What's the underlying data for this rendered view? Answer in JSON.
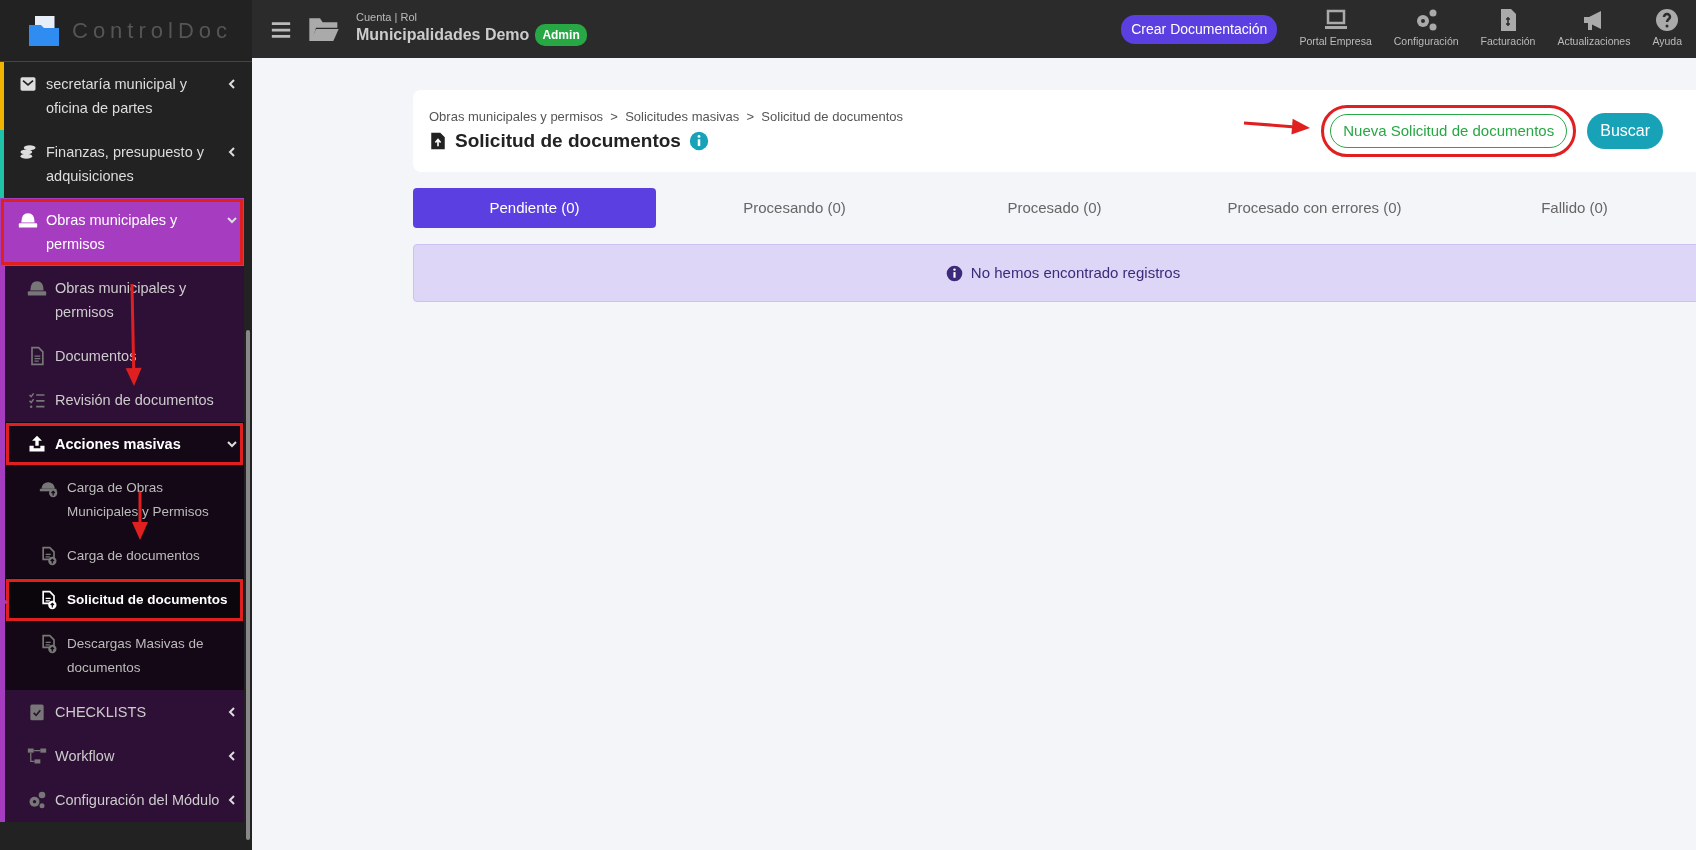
{
  "brand": {
    "name": "ControlDoc"
  },
  "header": {
    "account_label": "Cuenta | Rol",
    "account_name": "Municipalidades Demo",
    "role_badge": "Admin",
    "create_button": "Crear Documentación",
    "tools": [
      {
        "label": "Portal Empresa"
      },
      {
        "label": "Configuración"
      },
      {
        "label": "Facturación"
      },
      {
        "label": "Actualizaciones"
      },
      {
        "label": "Ayuda"
      }
    ]
  },
  "sidebar": {
    "items": [
      {
        "label": "secretaría municipal y oficina de partes",
        "color": "#f0b400",
        "expanded": false,
        "selected": false,
        "highlighted": false
      },
      {
        "label": "Finanzas, presupuesto y adquisiciones",
        "color": "#1fc3a8",
        "expanded": false,
        "selected": false,
        "highlighted": false
      },
      {
        "label": "Obras municipales y permisos",
        "color": "#a63cbf",
        "expanded": true,
        "selected": true,
        "highlighted": true,
        "children": [
          {
            "label": "Obras municipales y permisos",
            "selected": false,
            "highlighted": false
          },
          {
            "label": "Documentos",
            "selected": false,
            "highlighted": false
          },
          {
            "label": "Revisión de documentos",
            "selected": false,
            "highlighted": false
          },
          {
            "label": "Acciones masivas",
            "expanded": true,
            "selected": false,
            "highlighted": true,
            "children": [
              {
                "label": "Carga de Obras Municipales y Permisos",
                "selected": false,
                "highlighted": false
              },
              {
                "label": "Carga de documentos",
                "selected": false,
                "highlighted": false
              },
              {
                "label": "Solicitud de documentos",
                "selected": true,
                "highlighted": true
              },
              {
                "label": "Descargas Masivas de documentos",
                "selected": false,
                "highlighted": false
              }
            ]
          },
          {
            "label": "CHECKLISTS",
            "expanded": false,
            "selected": false,
            "highlighted": false
          },
          {
            "label": "Workflow",
            "expanded": false,
            "selected": false,
            "highlighted": false
          },
          {
            "label": "Configuración del Módulo",
            "expanded": false,
            "selected": false,
            "highlighted": false
          }
        ]
      }
    ]
  },
  "page": {
    "breadcrumb": [
      "Obras municipales y permisos",
      "Solicitudes masivas",
      "Solicitud de documentos"
    ],
    "separator": ">",
    "title": "Solicitud de documentos",
    "buttons": [
      {
        "label": "Nueva Solicitud de documentos",
        "kind": "outline",
        "highlighted": true
      },
      {
        "label": "Buscar",
        "kind": "solid",
        "highlighted": false
      }
    ],
    "tabs": [
      {
        "label": "Pendiente (0)",
        "selected": true
      },
      {
        "label": "Procesando (0)",
        "selected": false
      },
      {
        "label": "Procesado (0)",
        "selected": false
      },
      {
        "label": "Procesado con errores (0)",
        "selected": false
      },
      {
        "label": "Fallido (0)",
        "selected": false
      }
    ],
    "alert": "No hemos encontrado registros"
  }
}
